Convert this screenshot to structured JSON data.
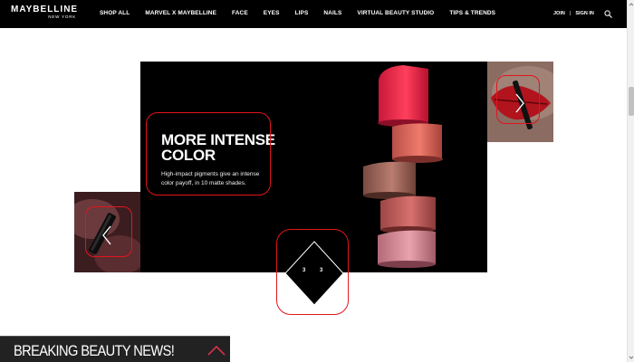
{
  "brand": {
    "name": "MAYBELLINE",
    "tagline": "NEW YORK"
  },
  "nav": {
    "items": [
      {
        "label": "SHOP ALL"
      },
      {
        "label": "MARVEL X MAYBELLINE"
      },
      {
        "label": "FACE"
      },
      {
        "label": "EYES"
      },
      {
        "label": "LIPS"
      },
      {
        "label": "NAILS"
      },
      {
        "label": "VIRTUAL BEAUTY STUDIO"
      },
      {
        "label": "TIPS & TRENDS"
      }
    ],
    "join_label": "JOIN",
    "separator": "|",
    "signin_label": "SIGN IN",
    "search_icon": "search-icon"
  },
  "carousel": {
    "slide_title": "MORE INTENSE COLOR",
    "slide_description": "High-impact pigments give an intense color payoff, in 10 matte shades.",
    "pager_current": "3",
    "pager_total": "3",
    "prev_icon": "chevron-left-icon",
    "next_icon": "chevron-right-icon"
  },
  "news_bar": {
    "label": "BREAKING BEAUTY NEWS!",
    "toggle_icon": "chevron-up-icon"
  },
  "colors": {
    "nav_background": "#000000",
    "highlight": "#e0161d",
    "slide_background": "#000000",
    "news_bar_background": "#222222"
  }
}
